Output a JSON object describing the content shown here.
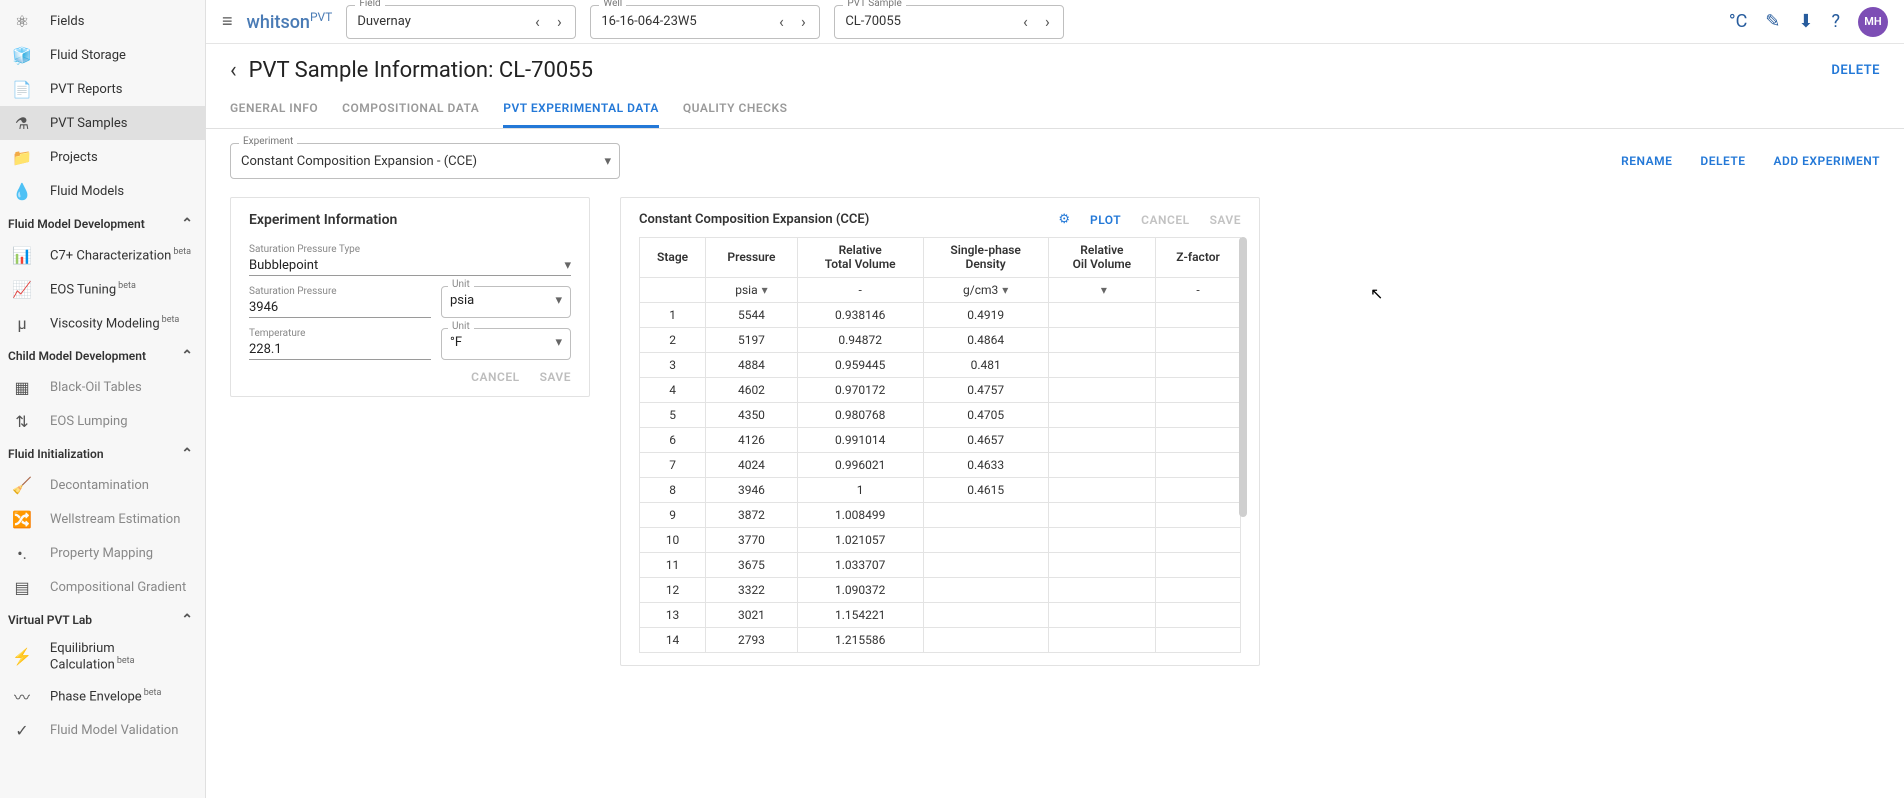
{
  "brand": {
    "name": "whitson",
    "suffix": "PVT"
  },
  "topbar": {
    "field_label": "Field",
    "field_value": "Duvernay",
    "well_label": "Well",
    "well_value": "16-16-064-23W5",
    "sample_label": "PVT Sample",
    "sample_value": "CL-70055",
    "avatar": "MH",
    "temp_icon": "°C"
  },
  "sidebar": {
    "items1": [
      {
        "icon": "⚛",
        "label": "Fields"
      },
      {
        "icon": "🧊",
        "label": "Fluid Storage"
      },
      {
        "icon": "📄",
        "label": "PVT Reports"
      },
      {
        "icon": "⚗",
        "label": "PVT Samples",
        "active": true
      },
      {
        "icon": "📁",
        "label": "Projects"
      },
      {
        "icon": "💧",
        "label": "Fluid Models"
      }
    ],
    "s1": "Fluid Model Development",
    "items2": [
      {
        "icon": "📊",
        "label": "C7+ Characterization",
        "beta": true
      },
      {
        "icon": "📈",
        "label": "EOS Tuning",
        "beta": true
      },
      {
        "icon": "μ",
        "label": "Viscosity Modeling",
        "beta": true
      }
    ],
    "s2": "Child Model Development",
    "items3": [
      {
        "icon": "▦",
        "label": "Black-Oil Tables",
        "disabled": true
      },
      {
        "icon": "⇅",
        "label": "EOS Lumping",
        "disabled": true
      }
    ],
    "s3": "Fluid Initialization",
    "items4": [
      {
        "icon": "🧹",
        "label": "Decontamination",
        "disabled": true
      },
      {
        "icon": "🔀",
        "label": "Wellstream Estimation",
        "disabled": true
      },
      {
        "icon": "•.",
        "label": "Property Mapping",
        "disabled": true
      },
      {
        "icon": "▤",
        "label": "Compositional Gradient",
        "disabled": true
      }
    ],
    "s4": "Virtual PVT Lab",
    "items5": [
      {
        "icon": "⚡",
        "label": "Equilibrium Calculation",
        "beta": true
      },
      {
        "icon": "〰",
        "label": "Phase Envelope",
        "beta": true
      },
      {
        "icon": "✓",
        "label": "Fluid Model Validation",
        "disabled": true
      }
    ]
  },
  "page": {
    "title": "PVT Sample Information: CL-70055",
    "delete": "DELETE"
  },
  "tabs": [
    "GENERAL INFO",
    "COMPOSITIONAL DATA",
    "PVT EXPERIMENTAL DATA",
    "QUALITY CHECKS"
  ],
  "exp": {
    "label": "Experiment",
    "value": "Constant Composition Expansion - (CCE)"
  },
  "exp_actions": {
    "rename": "RENAME",
    "delete": "DELETE",
    "add": "ADD EXPERIMENT"
  },
  "panel_exp": {
    "title": "Experiment Information",
    "sat_type_label": "Saturation Pressure Type",
    "sat_type_value": "Bubblepoint",
    "sat_press_label": "Saturation Pressure",
    "sat_press_value": "3946",
    "sat_press_unit_label": "Unit",
    "sat_press_unit_value": "psia",
    "temp_label": "Temperature",
    "temp_value": "228.1",
    "temp_unit_label": "Unit",
    "temp_unit_value": "°F",
    "cancel": "CANCEL",
    "save": "SAVE"
  },
  "table": {
    "title": "Constant Composition Expansion (CCE)",
    "plot": "PLOT",
    "cancel": "CANCEL",
    "save": "SAVE",
    "headers": [
      "Stage",
      "Pressure",
      "Relative\nTotal Volume",
      "Single-phase\nDensity",
      "Relative\nOil Volume",
      "Z-factor"
    ],
    "units": [
      "",
      "psia",
      "-",
      "g/cm3",
      "",
      "-"
    ],
    "rows": [
      [
        "1",
        "5544",
        "0.938146",
        "0.4919",
        "",
        ""
      ],
      [
        "2",
        "5197",
        "0.94872",
        "0.4864",
        "",
        ""
      ],
      [
        "3",
        "4884",
        "0.959445",
        "0.481",
        "",
        ""
      ],
      [
        "4",
        "4602",
        "0.970172",
        "0.4757",
        "",
        ""
      ],
      [
        "5",
        "4350",
        "0.980768",
        "0.4705",
        "",
        ""
      ],
      [
        "6",
        "4126",
        "0.991014",
        "0.4657",
        "",
        ""
      ],
      [
        "7",
        "4024",
        "0.996021",
        "0.4633",
        "",
        ""
      ],
      [
        "8",
        "3946",
        "1",
        "0.4615",
        "",
        ""
      ],
      [
        "9",
        "3872",
        "1.008499",
        "",
        "",
        ""
      ],
      [
        "10",
        "3770",
        "1.021057",
        "",
        "",
        ""
      ],
      [
        "11",
        "3675",
        "1.033707",
        "",
        "",
        ""
      ],
      [
        "12",
        "3322",
        "1.090372",
        "",
        "",
        ""
      ],
      [
        "13",
        "3021",
        "1.154221",
        "",
        "",
        ""
      ],
      [
        "14",
        "2793",
        "1.215586",
        "",
        "",
        ""
      ]
    ]
  }
}
